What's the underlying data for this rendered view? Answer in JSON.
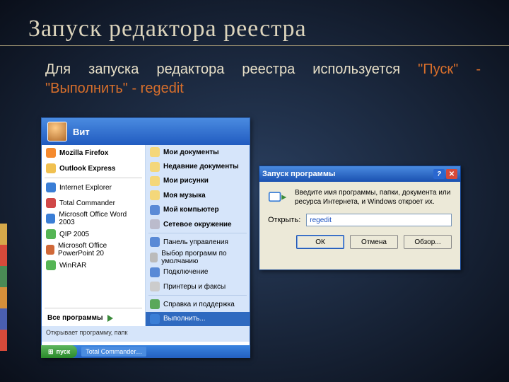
{
  "slide": {
    "title": "Запуск редактора реестра",
    "desc_pre": "Для запуска редактора реестра используется ",
    "desc_accent": "\"Пуск\" - \"Выполнить\" - regedit"
  },
  "startmenu": {
    "username": "Вит",
    "left_bold": [
      {
        "icon": "i-ff",
        "label": "Mozilla Firefox"
      },
      {
        "icon": "i-oe",
        "label": "Outlook Express"
      }
    ],
    "left_mru": [
      {
        "icon": "i-ie",
        "label": "Internet Explorer"
      },
      {
        "icon": "i-tc",
        "label": "Total Commander"
      },
      {
        "icon": "i-wd",
        "label": "Microsoft Office Word 2003"
      },
      {
        "icon": "i-qi",
        "label": "QIP 2005"
      },
      {
        "icon": "i-pp",
        "label": "Microsoft Office PowerPoint 20"
      },
      {
        "icon": "i-wr",
        "label": "WinRAR"
      }
    ],
    "allprograms": "Все программы",
    "right_top": [
      {
        "icon": "i-doc",
        "label": "Мои документы"
      },
      {
        "icon": "i-rec",
        "label": "Недавние документы"
      },
      {
        "icon": "i-pic",
        "label": "Мои рисунки"
      },
      {
        "icon": "i-mus",
        "label": "Моя музыка"
      },
      {
        "icon": "i-pc",
        "label": "Мой компьютер"
      },
      {
        "icon": "i-net",
        "label": "Сетевое окружение"
      }
    ],
    "right_mid": [
      {
        "icon": "i-ctl",
        "label": "Панель управления"
      },
      {
        "icon": "i-def",
        "label": "Выбор программ по умолчанию"
      },
      {
        "icon": "i-con",
        "label": "Подключение"
      },
      {
        "icon": "i-prn",
        "label": "Принтеры и факсы"
      }
    ],
    "right_bot": [
      {
        "icon": "i-hlp",
        "label": "Справка и поддержка"
      }
    ],
    "run_item": "Выполнить...",
    "footer": "Открывает программу, папк"
  },
  "taskbar": {
    "start": "пуск",
    "task": "Total Commander…"
  },
  "rundlg": {
    "title": "Запуск программы",
    "hint": "Введите имя программы, папки, документа или ресурса Интернета, и Windows откроет их.",
    "open_label": "Открыть:",
    "value": "regedit",
    "ok": "ОК",
    "cancel": "Отмена",
    "browse": "Обзор..."
  },
  "cbars": [
    "#d6a84a",
    "#d64a3a",
    "#4a8a55",
    "#d68f3a",
    "#4a5fb0",
    "#d64a3a"
  ]
}
